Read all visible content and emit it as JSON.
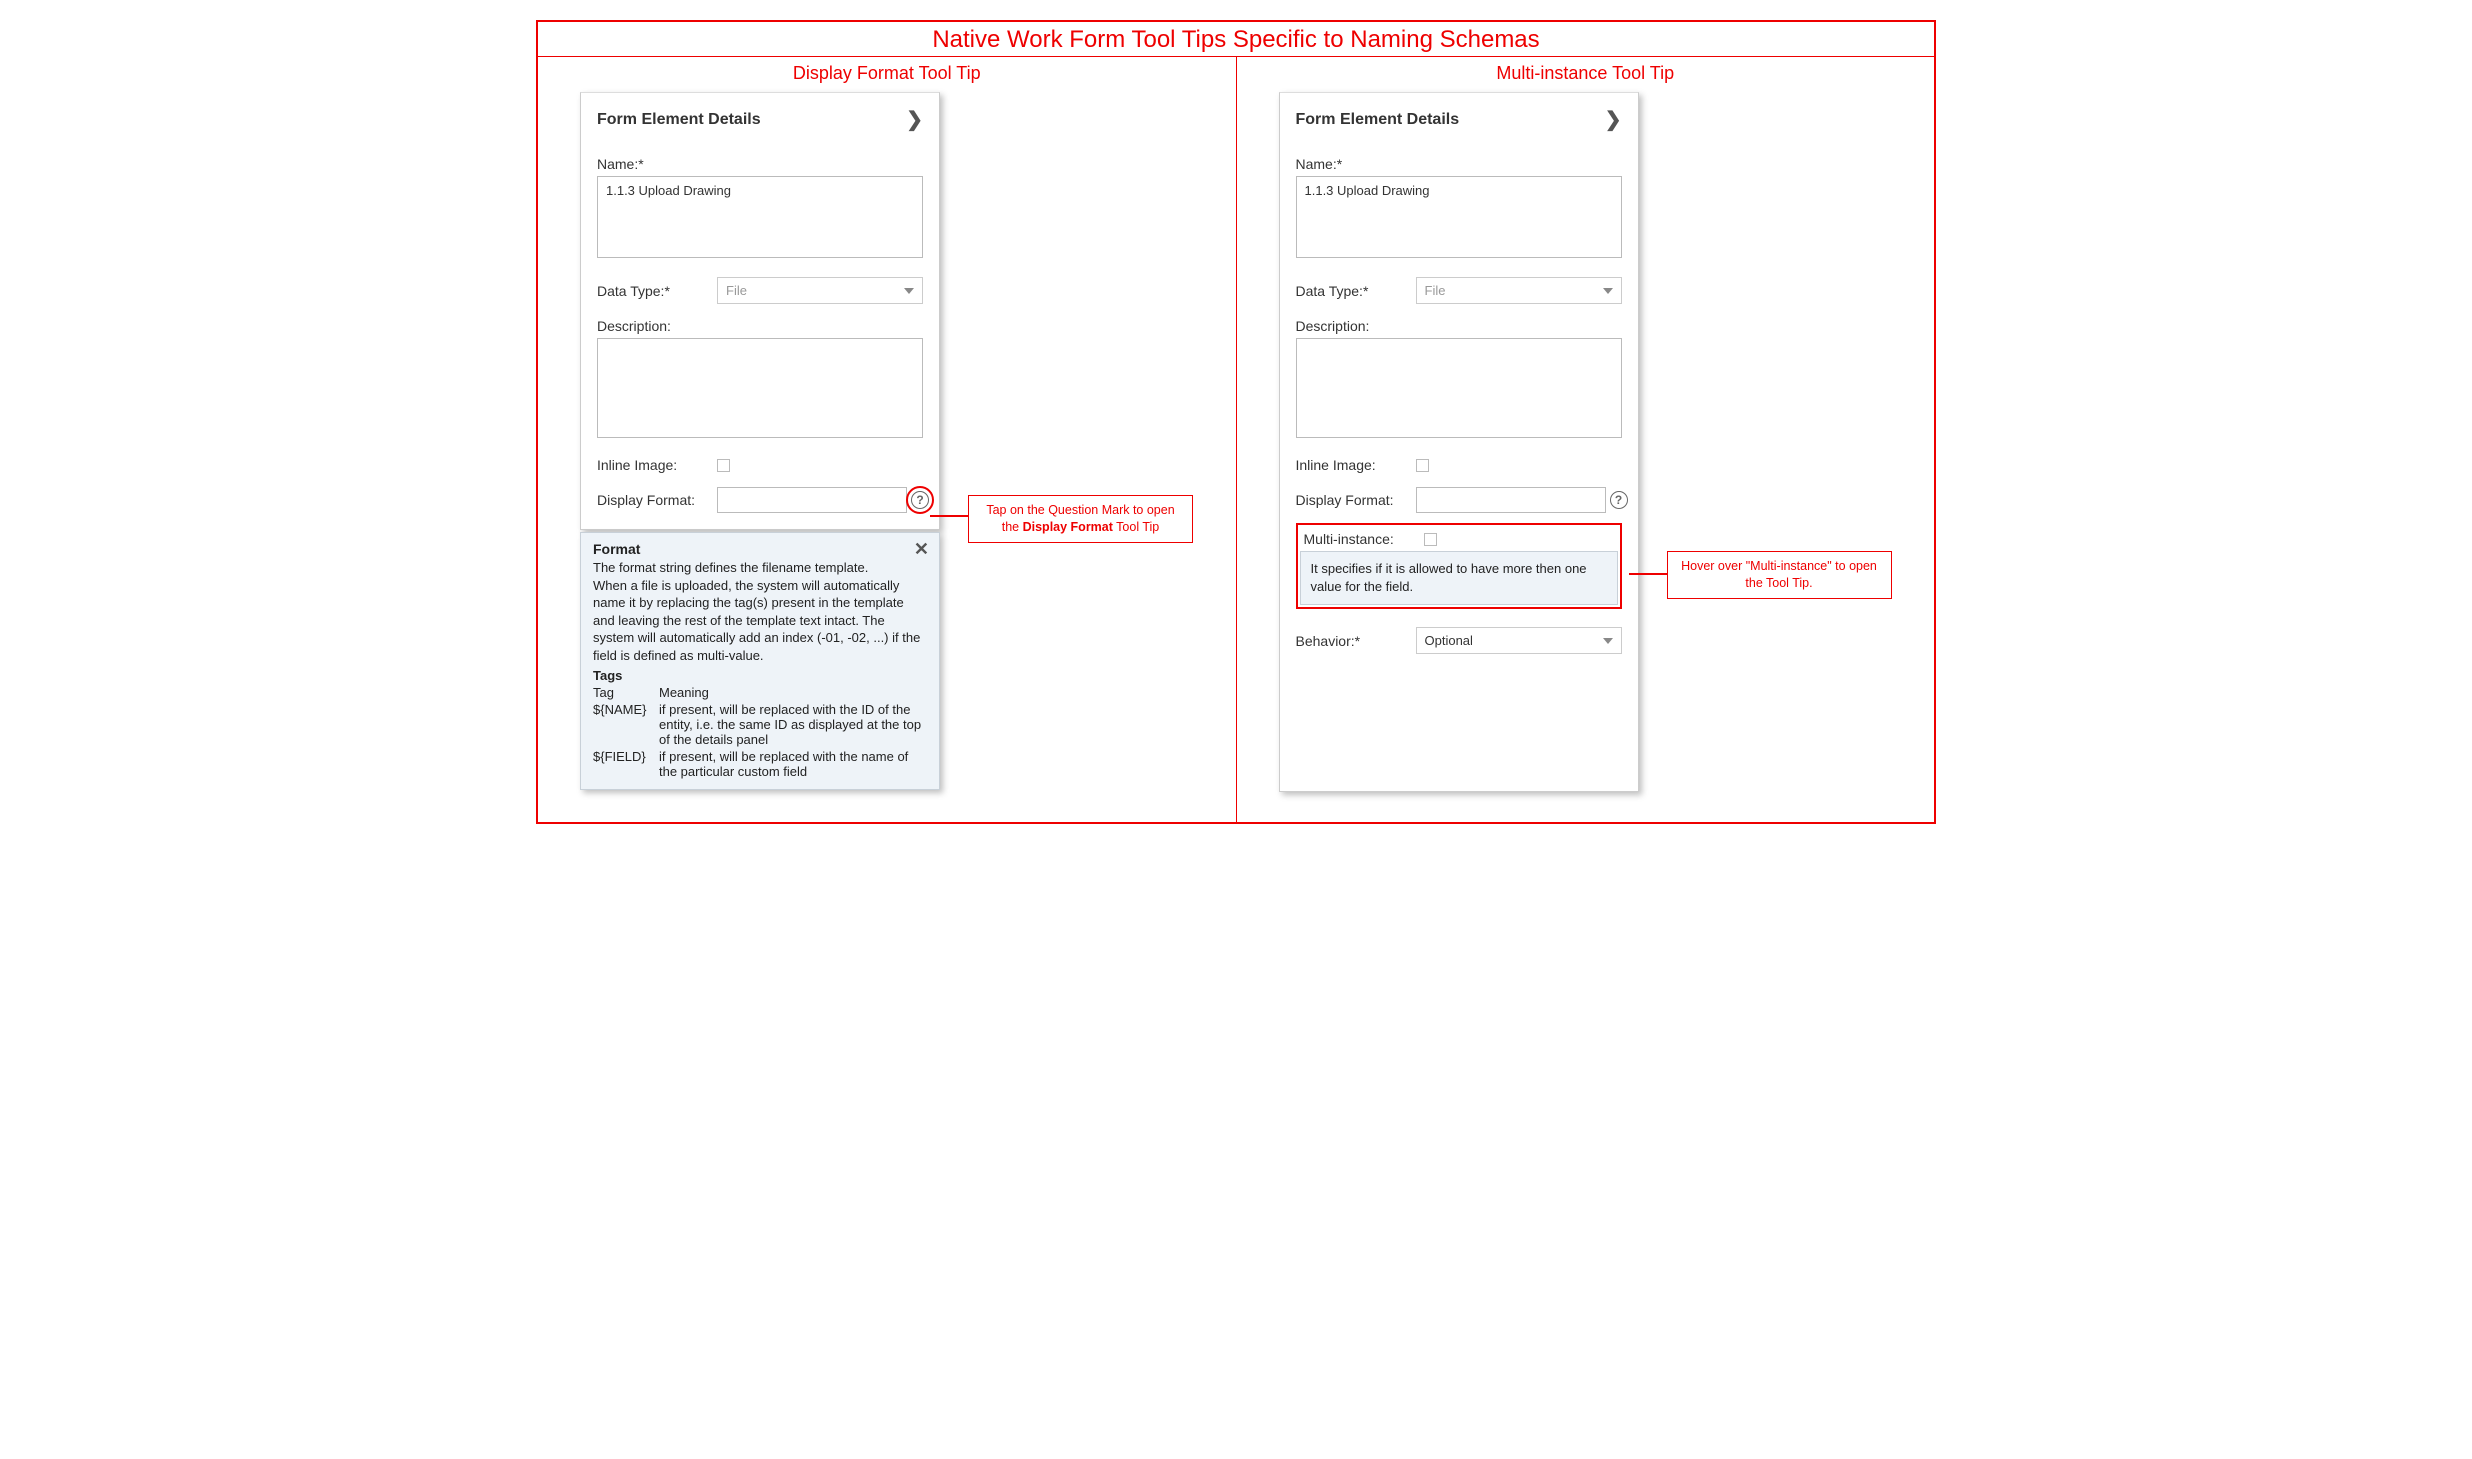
{
  "main_title": "Native Work Form Tool Tips Specific to Naming Schemas",
  "left": {
    "col_title": "Display Format Tool Tip",
    "panel_title": "Form Element Details",
    "name_label": "Name:*",
    "name_value": "1.1.3 Upload Drawing",
    "datatype_label": "Data Type:*",
    "datatype_value": "File",
    "description_label": "Description:",
    "description_value": "",
    "inline_image_label": "Inline Image:",
    "display_format_label": "Display Format:",
    "display_format_value": "",
    "callout_pre": "Tap on the Question Mark to open the ",
    "callout_bold": "Display Format",
    "callout_post": " Tool Tip",
    "tooltip": {
      "title": "Format",
      "body": "The format string defines the filename template.\nWhen a file is uploaded, the system will automatically name it by replacing the tag(s) present in the template and leaving the rest of the template text intact. The system will automatically add an index (-01, -02, ...) if the field is defined as multi-value.",
      "tags_title": "Tags",
      "tag_col1": "Tag",
      "tag_col2": "Meaning",
      "tags": [
        {
          "tag": "${NAME}",
          "meaning": "if present, will be replaced with the ID of the entity, i.e. the same ID as displayed at the top of the details panel"
        },
        {
          "tag": "${FIELD}",
          "meaning": "if present, will be replaced with the name of the particular custom field"
        }
      ]
    }
  },
  "right": {
    "col_title": "Multi-instance Tool Tip",
    "panel_title": "Form Element Details",
    "name_label": "Name:*",
    "name_value": "1.1.3 Upload Drawing",
    "datatype_label": "Data Type:*",
    "datatype_value": "File",
    "description_label": "Description:",
    "description_value": "",
    "inline_image_label": "Inline Image:",
    "display_format_label": "Display Format:",
    "display_format_value": "",
    "multi_instance_label": "Multi-instance:",
    "mi_tooltip_text": "It specifies if it is allowed to have more then one value for the field.",
    "behavior_label": "Behavior:*",
    "behavior_value": "Optional",
    "callout_text": "Hover over \"Multi-instance\" to open the Tool Tip."
  }
}
